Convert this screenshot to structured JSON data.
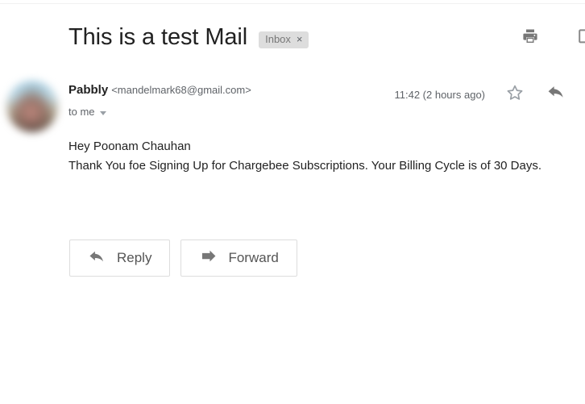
{
  "header": {
    "subject": "This is a test Mail",
    "label_chip": {
      "text": "Inbox",
      "close": "×"
    },
    "actions": [
      {
        "name": "print-icon",
        "title": "Print all"
      },
      {
        "name": "open-in-new-window-icon",
        "title": "In new window"
      }
    ]
  },
  "message": {
    "sender_name": "Pabbly",
    "sender_email": "<mandelmark68@gmail.com>",
    "recipient": "to me",
    "timestamp": "11:42 (2 hours ago)",
    "body_lines": [
      "Hey Poonam Chauhan",
      "Thank You foe Signing Up for Chargebee Subscriptions. Your Billing Cycle is of 30 Days."
    ]
  },
  "buttons": {
    "reply_label": "Reply",
    "forward_label": "Forward"
  },
  "colors": {
    "text_primary": "#222222",
    "text_secondary": "#5f6368",
    "icon_gray": "#777777",
    "chip_background": "#dddddd",
    "border": "#dddddd"
  }
}
